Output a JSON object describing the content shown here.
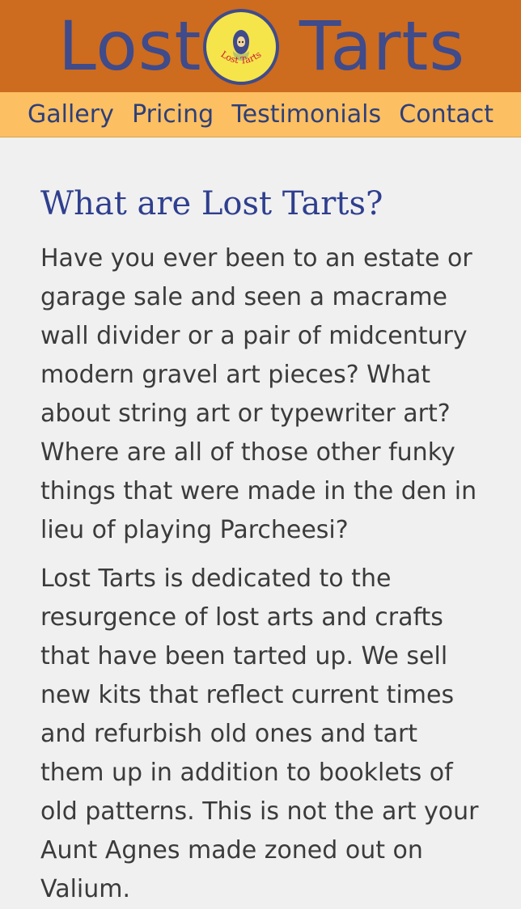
{
  "header": {
    "brand_left": "Lost",
    "brand_right": "Tarts",
    "logo_text": "Lost Tarts",
    "colors": {
      "header_background": "#cd6b1f",
      "nav_background": "#fcbf62",
      "logo_fill": "#f6e44b",
      "brand_text": "#3f4b8a"
    }
  },
  "nav": {
    "items": [
      {
        "label": "Gallery"
      },
      {
        "label": "Pricing"
      },
      {
        "label": "Testimonials"
      },
      {
        "label": "Contact"
      }
    ]
  },
  "main": {
    "title": "What are Lost Tarts?",
    "paragraph_1": "Have you ever been to an estate or garage sale and seen a macrame wall divider or a pair of midcentury modern gravel art pieces? What about string art or typewriter art? Where are all of those other funky things that were made in the den in lieu of playing Parcheesi?",
    "paragraph_2": "Lost Tarts is dedicated to the resurgence of lost arts and crafts that have been tarted up. We sell new kits that reflect current times and refurbish old ones and tart them up in addition to booklets of old patterns. This is not the art your Aunt Agnes made zoned out on Valium."
  }
}
